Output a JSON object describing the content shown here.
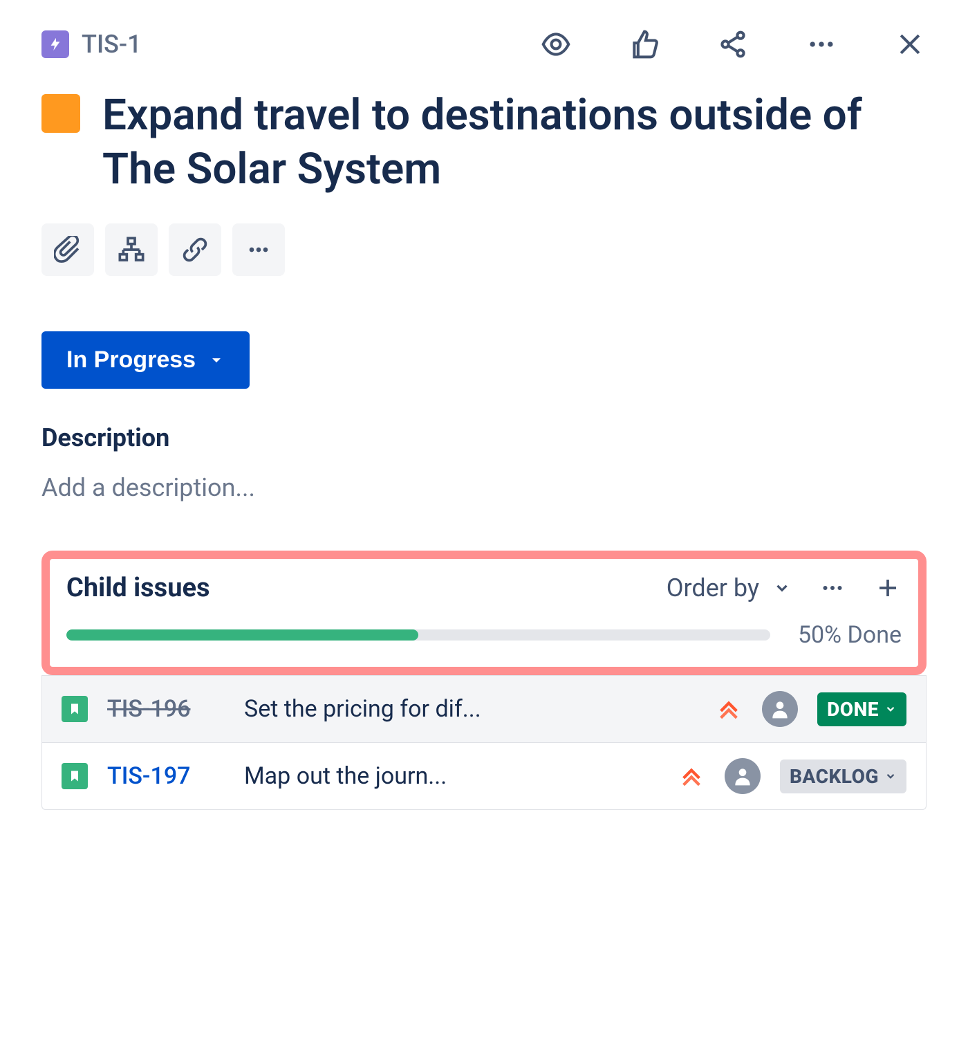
{
  "breadcrumb": {
    "key": "TIS-1"
  },
  "issue": {
    "title": "Expand travel to destinations outside of The Solar System",
    "epic_color": "#FF991F"
  },
  "status": {
    "label": "In Progress"
  },
  "description": {
    "label": "Description",
    "placeholder": "Add a description..."
  },
  "child_issues": {
    "title": "Child issues",
    "order_by_label": "Order by",
    "progress_percent": 50,
    "progress_label": "50% Done",
    "items": [
      {
        "key": "TIS-196",
        "summary": "Set the pricing for dif...",
        "status_label": "DONE",
        "status_kind": "done",
        "key_done": true
      },
      {
        "key": "TIS-197",
        "summary": "Map out the journ...",
        "status_label": "BACKLOG",
        "status_kind": "backlog",
        "key_done": false
      }
    ]
  }
}
